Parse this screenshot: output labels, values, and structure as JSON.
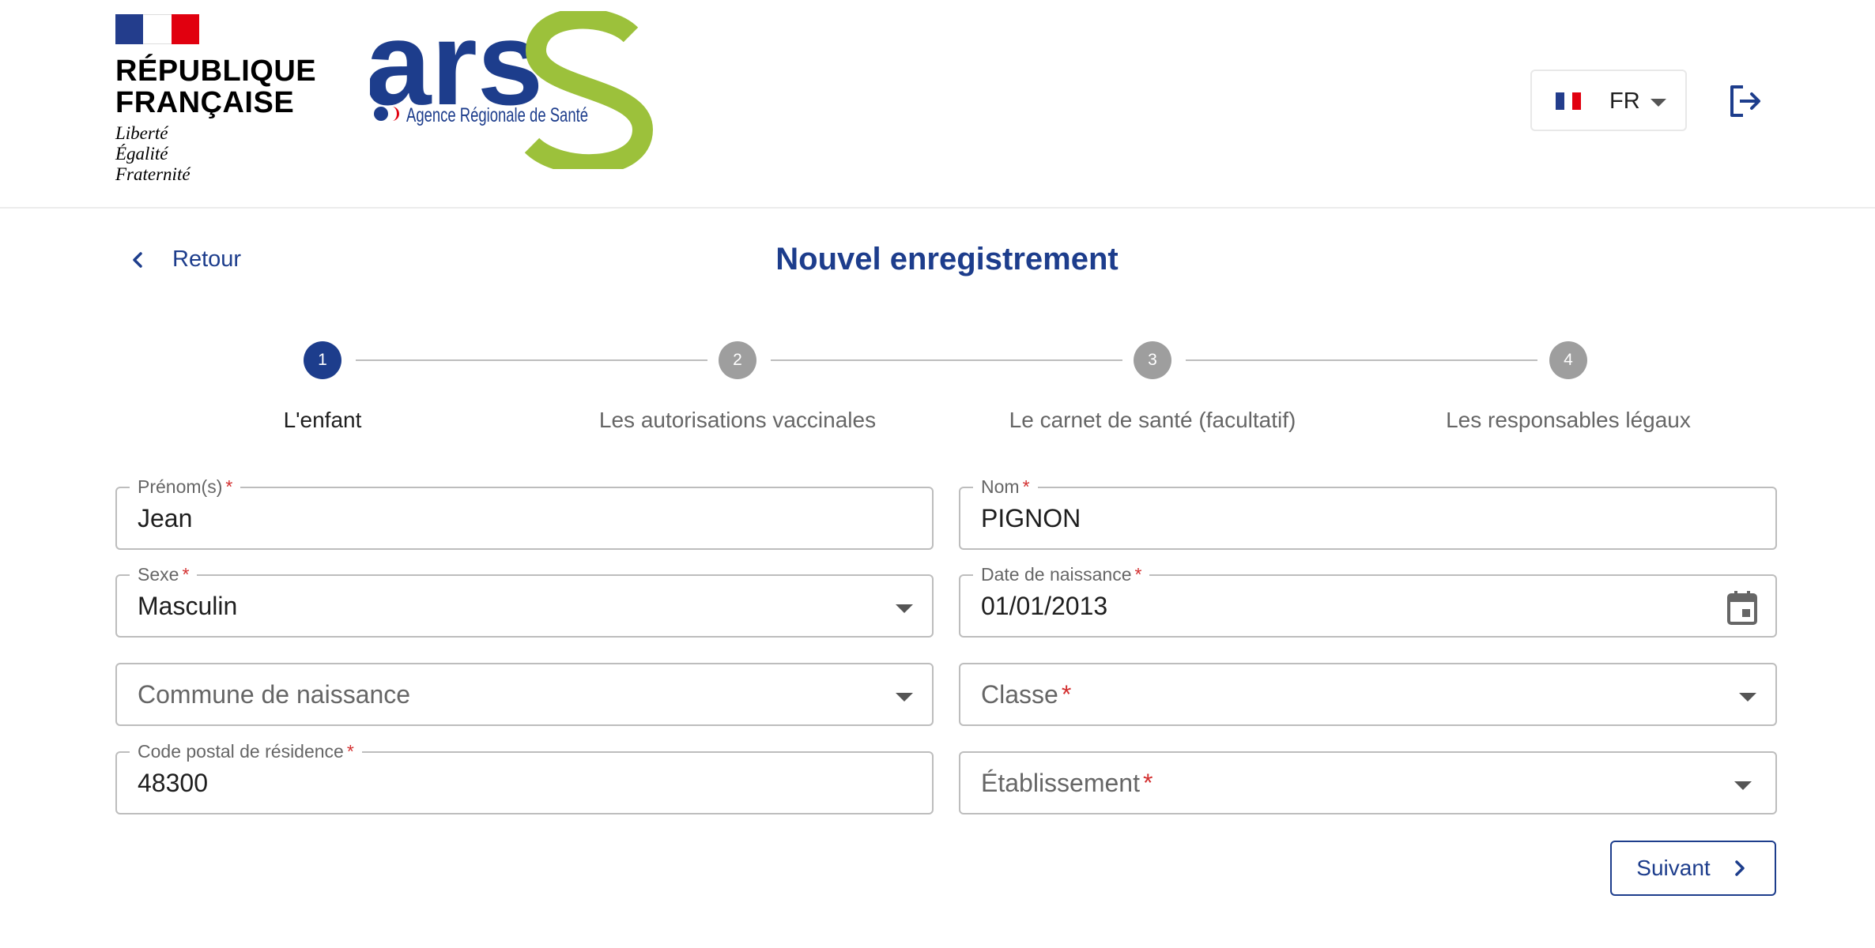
{
  "header": {
    "republique_logo": {
      "line1": "RÉPUBLIQUE",
      "line2": "FRANÇAISE",
      "motto": [
        "Liberté",
        "Égalité",
        "Fraternité"
      ]
    },
    "ars_logo": {
      "letters": "ars",
      "tagline": "Agence Régionale de Santé"
    },
    "language": {
      "code": "FR",
      "flag_icon": "france-flag-icon"
    },
    "logout_icon": "logout-icon"
  },
  "page": {
    "back_label": "Retour",
    "title": "Nouvel enregistrement"
  },
  "stepper": {
    "steps": [
      {
        "number": "1",
        "label": "L'enfant",
        "active": true
      },
      {
        "number": "2",
        "label": "Les autorisations vaccinales",
        "active": false
      },
      {
        "number": "3",
        "label": "Le carnet de santé (facultatif)",
        "active": false
      },
      {
        "number": "4",
        "label": "Les responsables légaux",
        "active": false
      }
    ]
  },
  "form": {
    "prenom": {
      "label": "Prénom(s)",
      "required_mark": "*",
      "value": "Jean"
    },
    "nom": {
      "label": "Nom",
      "required_mark": "*",
      "value": "PIGNON"
    },
    "sexe": {
      "label": "Sexe",
      "required_mark": "*",
      "value": "Masculin"
    },
    "date_naissance": {
      "label": "Date de naissance",
      "required_mark": "*",
      "value": "01/01/2013"
    },
    "commune": {
      "placeholder": "Commune de naissance"
    },
    "classe": {
      "placeholder": "Classe",
      "required_mark": "*"
    },
    "code_postal": {
      "label": "Code postal de résidence",
      "required_mark": "*",
      "value": "48300"
    },
    "etablissement": {
      "placeholder": "Établissement",
      "required_mark": "*"
    }
  },
  "actions": {
    "next_label": "Suivant"
  },
  "colors": {
    "primary": "#1d3d8c",
    "ars_green": "#9cc13b",
    "required": "#d32f2f",
    "step_inactive": "#9e9e9e"
  }
}
